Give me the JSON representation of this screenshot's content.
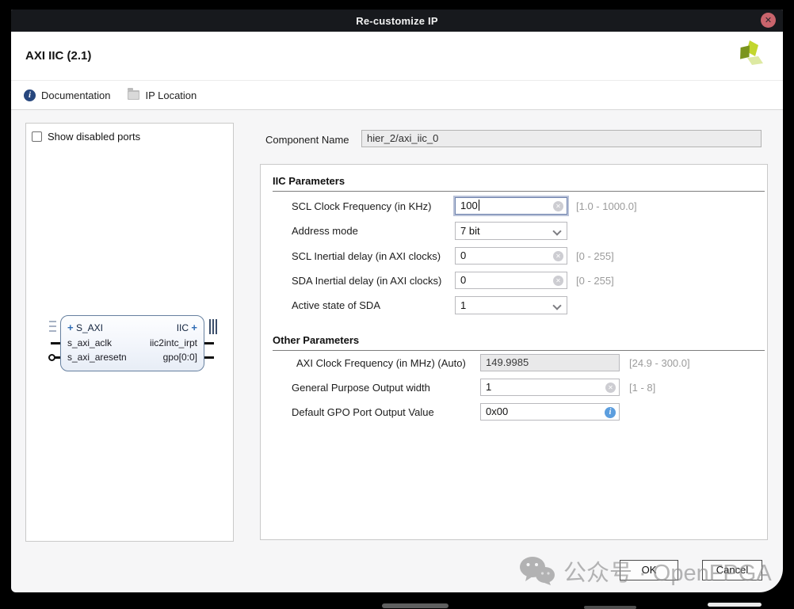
{
  "window": {
    "title": "Re-customize IP",
    "close_glyph": "✕"
  },
  "header": {
    "title": "AXI IIC (2.1)"
  },
  "toolbar": {
    "documentation_label": "Documentation",
    "ip_location_label": "IP Location",
    "info_glyph": "i"
  },
  "ports_panel": {
    "show_disabled_label": "Show disabled ports",
    "block": {
      "left_interface": "S_AXI",
      "right_interface": "IIC",
      "plus_glyph": "+",
      "left_pins": [
        "s_axi_aclk",
        "s_axi_aresetn"
      ],
      "right_pins": [
        "iic2intc_irpt",
        "gpo[0:0]"
      ]
    }
  },
  "component_name": {
    "label": "Component Name",
    "value": "hier_2/axi_iic_0"
  },
  "iic_parameters": {
    "heading": "IIC Parameters",
    "rows": [
      {
        "label": "SCL Clock Frequency (in KHz)",
        "value": "100",
        "range": "[1.0 - 1000.0]",
        "type": "text-focused"
      },
      {
        "label": "Address mode",
        "value": "7 bit",
        "range": "",
        "type": "select"
      },
      {
        "label": "SCL Inertial delay (in AXI clocks)",
        "value": "0",
        "range": "[0 - 255]",
        "type": "text"
      },
      {
        "label": "SDA Inertial delay (in AXI clocks)",
        "value": "0",
        "range": "[0 - 255]",
        "type": "text"
      },
      {
        "label": "Active state of SDA",
        "value": "1",
        "range": "",
        "type": "select"
      }
    ]
  },
  "other_parameters": {
    "heading": "Other Parameters",
    "rows": [
      {
        "label": "AXI Clock Frequency (in MHz) (Auto)",
        "value": "149.9985",
        "range": "[24.9 - 300.0]",
        "type": "disabled"
      },
      {
        "label": "General Purpose Output width",
        "value": "1",
        "range": "[1 - 8]",
        "type": "text"
      },
      {
        "label": "Default GPO Port Output Value",
        "value": "0x00",
        "range": "",
        "type": "text-info"
      }
    ]
  },
  "footer": {
    "ok_label": "OK",
    "cancel_label": "Cancel"
  },
  "watermark": {
    "text": "公众号 · OpenFPGA"
  },
  "colors": {
    "titlebar": "#17191d",
    "close_button": "#c9646c",
    "accent_blue": "#2f6db5",
    "focus_border": "#6e82ad",
    "info_icon_blue": "#5c9ede",
    "block_border": "#66809f",
    "logo_dark_green": "#7a941d",
    "logo_bright_green": "#c2d62e",
    "logo_light_green": "#dde9a2"
  }
}
